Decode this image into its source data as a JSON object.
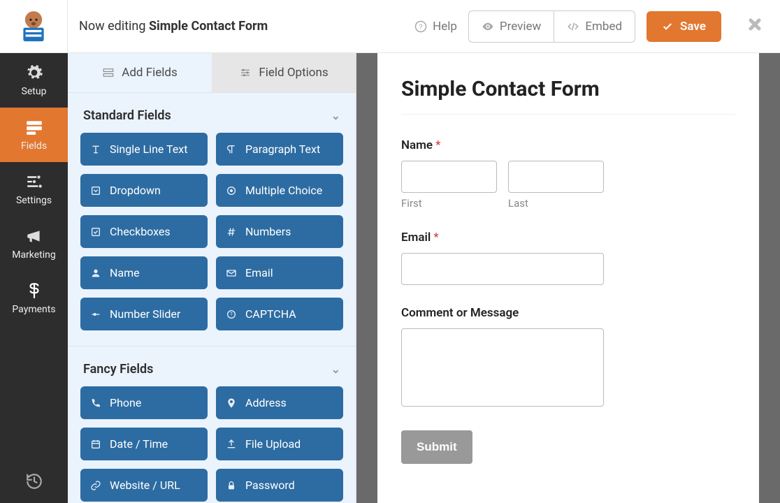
{
  "header": {
    "title_prefix": "Now editing ",
    "title_name": "Simple Contact Form",
    "help": "Help",
    "preview": "Preview",
    "embed": "Embed",
    "save": "Save"
  },
  "nav": {
    "setup": "Setup",
    "fields": "Fields",
    "settings": "Settings",
    "marketing": "Marketing",
    "payments": "Payments"
  },
  "tabs": {
    "add": "Add Fields",
    "options": "Field Options"
  },
  "sections": {
    "standard": "Standard Fields",
    "fancy": "Fancy Fields"
  },
  "std": {
    "single": "Single Line Text",
    "paragraph": "Paragraph Text",
    "dropdown": "Dropdown",
    "multiple": "Multiple Choice",
    "checkboxes": "Checkboxes",
    "numbers": "Numbers",
    "name": "Name",
    "email": "Email",
    "slider": "Number Slider",
    "captcha": "CAPTCHA"
  },
  "fancy": {
    "phone": "Phone",
    "address": "Address",
    "date": "Date / Time",
    "upload": "File Upload",
    "url": "Website / URL",
    "password": "Password"
  },
  "form": {
    "title": "Simple Contact Form",
    "name_label": "Name",
    "first": "First",
    "last": "Last",
    "email_label": "Email",
    "comment_label": "Comment or Message",
    "submit": "Submit",
    "required": "*"
  }
}
